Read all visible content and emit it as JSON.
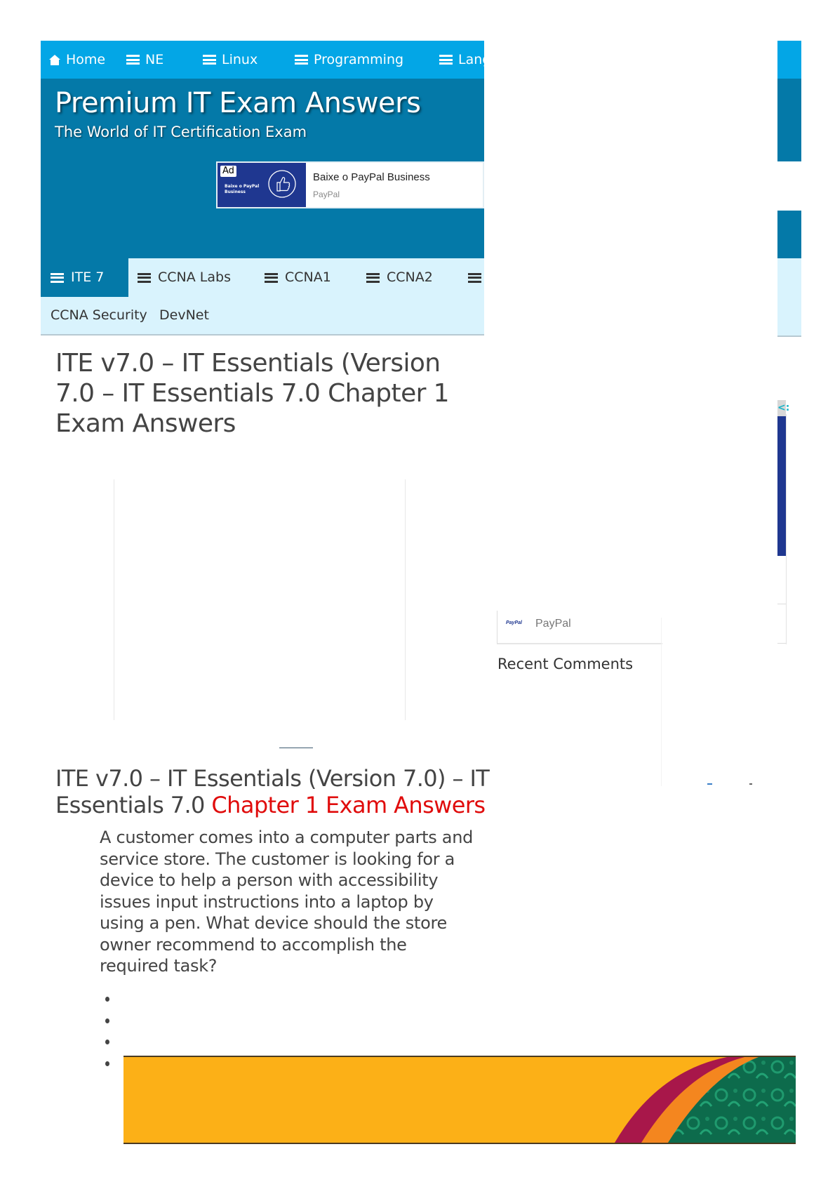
{
  "top_nav": {
    "items": [
      {
        "label": "Home",
        "icon": "home-icon"
      },
      {
        "label": "NE",
        "icon": "menu-icon"
      },
      {
        "label": "Linux",
        "icon": "menu-icon"
      },
      {
        "label": "Programming",
        "icon": "menu-icon"
      },
      {
        "label": "Lang",
        "icon": "menu-icon"
      }
    ],
    "bg_color": "#03a6e6"
  },
  "header": {
    "title": "Premium IT Exam Answers",
    "tagline": "The World of IT Certification Exam",
    "bg_color": "#0479a8",
    "ad": {
      "badge": "Ad",
      "image_text": "Baixe o PayPal Business",
      "title": "Baixe o PayPal Business",
      "source": "PayPal"
    }
  },
  "sub_nav": {
    "tabs": [
      {
        "label": "ITE 7",
        "active": true
      },
      {
        "label": "CCNA Labs",
        "active": false
      },
      {
        "label": "CCNA1",
        "active": false
      },
      {
        "label": "CCNA2",
        "active": false
      },
      {
        "label": "",
        "active": false
      }
    ],
    "row2": [
      "CCNA Security",
      "DevNet"
    ]
  },
  "post": {
    "title": "ITE v7.0 – IT Essentials (Version 7.0 – IT Essentials 7.0 Chapter 1 Exam Answers",
    "content_title_plain": "ITE v7.0 – IT Essentials (Version 7.0) – IT Essentials 7.0 ",
    "content_title_highlight": "Chapter 1 Exam Answers",
    "highlight_color": "#e00c0c",
    "question": "A customer comes into a computer parts and service store. The customer is looking for a device to help a person with accessibility issues input instructions into a laptop by using a pen. What device should the store owner recommend to accomplish the required task?",
    "answer_count": 4
  },
  "sidebar": {
    "ad_tab_glyph": "<:",
    "paypal_widget": {
      "logo": "PayPal",
      "name": "PayPal"
    },
    "recent_comments_heading": "Recent Comments"
  }
}
